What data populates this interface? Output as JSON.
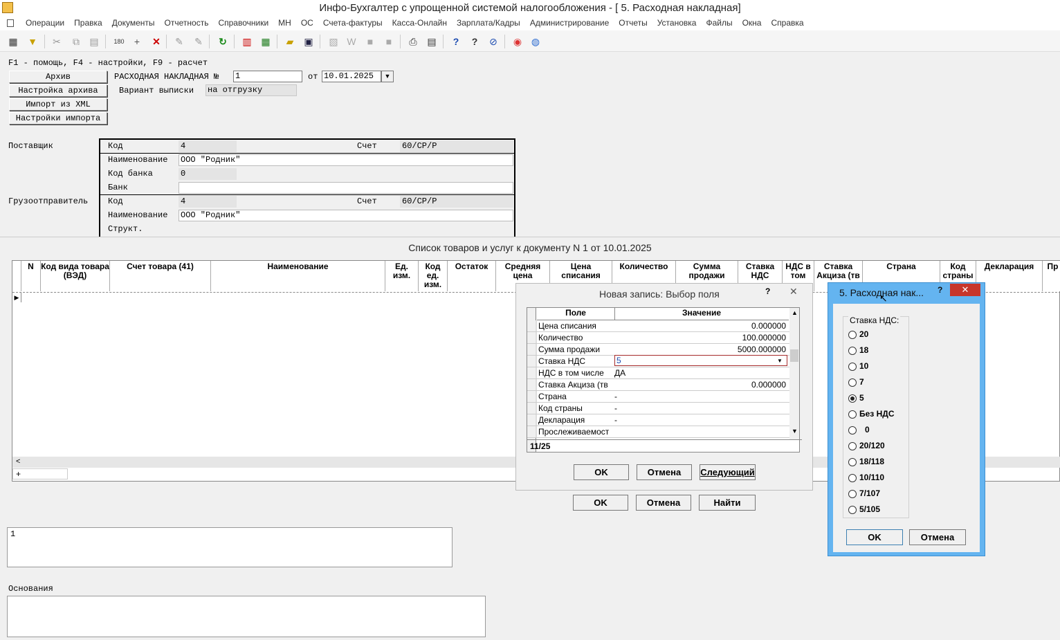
{
  "window": {
    "title": "Инфо-Бухгалтер с упрощенной системой налогообложения - [  5. Расходная накладная]"
  },
  "menu": [
    "Операции",
    "Правка",
    "Документы",
    "Отчетность",
    "Справочники",
    "МН",
    "ОС",
    "Счета-фактуры",
    "Касса-Онлайн",
    "Зарплата/Кадры",
    "Администрирование",
    "Отчеты",
    "Установка",
    "Файлы",
    "Окна",
    "Справка"
  ],
  "hint": "F1 - помощь, F4 - настройки, F9 - расчет",
  "side_buttons": [
    "Архив",
    "Настройка архива",
    "Импорт из XML",
    "Настройки импорта"
  ],
  "doc": {
    "title_label": "РАСХОДНАЯ НАКЛАДНАЯ №",
    "number": "1",
    "from_label": "от",
    "date": "10.01.2025",
    "variant_label": "Вариант выписки",
    "variant_value": "на отгрузку"
  },
  "supplier": {
    "section": "Поставщик",
    "code_label": "Код",
    "code": "4",
    "account_label": "Счет",
    "account": "60/СР/Р",
    "name_label": "Наименование",
    "name": "ООО \"Родник\"",
    "bank_code_label": "Код банка",
    "bank_code": "0",
    "bank_label": "Банк",
    "bank": ""
  },
  "shipper": {
    "section": "Грузоотправитель",
    "code_label": "Код",
    "code": "4",
    "account_label": "Счет",
    "account": "60/СР/Р",
    "name_label": "Наименование",
    "name": "ООО \"Родник\"",
    "struct_label": "Структ."
  },
  "goods": {
    "title": "Список товаров и услуг к документу N 1 от 10.01.2025",
    "columns": [
      "N",
      "Код вида товара (ВЭД)",
      "Счет товара (41)",
      "Наименование",
      "Ед. изм.",
      "Код ед. изм.",
      "Остаток",
      "Средняя цена",
      "Цена списания",
      "Количество",
      "Сумма продажи",
      "Ставка НДС",
      "НДС в том",
      "Ставка Акциза (тв",
      "Страна",
      "Код страны",
      "Декларация",
      "Пр"
    ],
    "add_row_symbol": "+"
  },
  "notes_value": "1",
  "basis_label": "Основания",
  "field_dialog": {
    "title": "Новая запись: Выбор поля",
    "help": "?",
    "col_field": "Поле",
    "col_value": "Значение",
    "rows": [
      {
        "field": "Цена списания",
        "value": "0.000000",
        "num": true
      },
      {
        "field": "Количество",
        "value": "100.000000",
        "num": true
      },
      {
        "field": "Сумма продажи",
        "value": "5000.000000",
        "num": true
      },
      {
        "field": "Ставка НДС",
        "value": "5",
        "num": false,
        "active": true
      },
      {
        "field": "НДС в том числе",
        "value": "ДА",
        "num": false
      },
      {
        "field": "Ставка Акциза (тв",
        "value": "0.000000",
        "num": true
      },
      {
        "field": "Страна",
        "value": "-",
        "num": false
      },
      {
        "field": "Код страны",
        "value": "-",
        "num": false
      },
      {
        "field": "Декларация",
        "value": "-",
        "num": false
      },
      {
        "field": "Прослеживаемост",
        "value": "",
        "num": false
      }
    ],
    "position": "11/25",
    "ok": "OK",
    "cancel": "Отмена",
    "next": "Следующий"
  },
  "outer_buttons": {
    "ok": "OK",
    "cancel": "Отмена",
    "find": "Найти"
  },
  "vat_dialog": {
    "title": "5. Расходная нак...",
    "help": "?",
    "group_label": "Ставка НДС:",
    "options": [
      "20",
      "18",
      "10",
      "7",
      "5",
      "Без НДС",
      "0",
      "20/120",
      "18/118",
      "10/110",
      "7/107",
      "5/105"
    ],
    "selected": "5",
    "ok": "OK",
    "cancel": "Отмена"
  }
}
